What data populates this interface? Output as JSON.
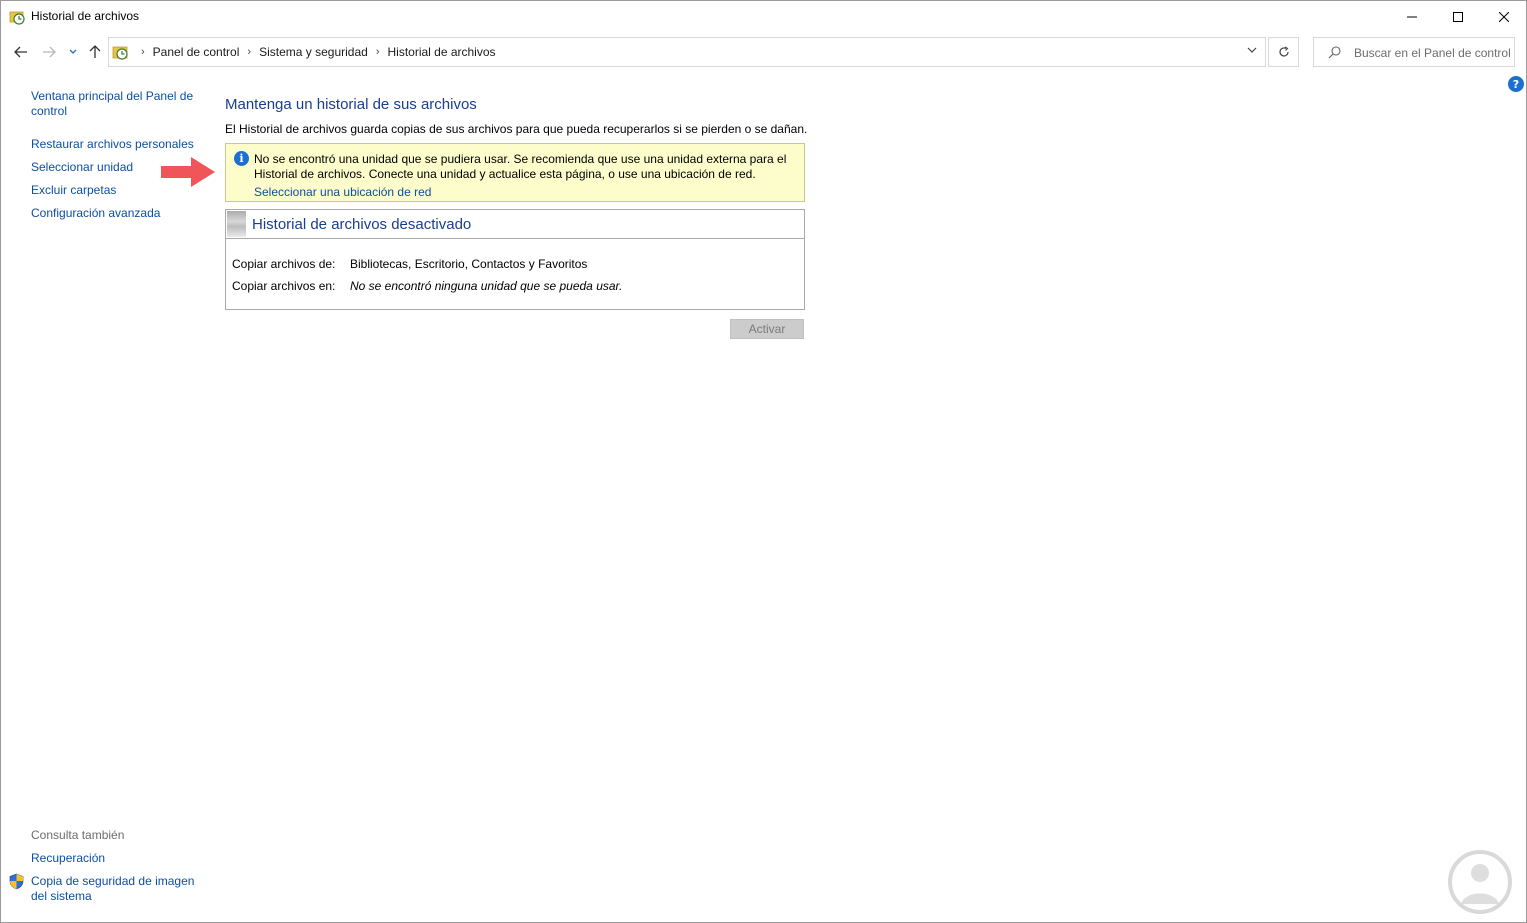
{
  "window": {
    "title": "Historial de archivos"
  },
  "address": {
    "crumbs": [
      "Panel de control",
      "Sistema y seguridad",
      "Historial de archivos"
    ]
  },
  "search": {
    "placeholder": "Buscar en el Panel de control"
  },
  "help": {
    "label": "?"
  },
  "leftnav": {
    "home_label": "Ventana principal del Panel de control",
    "items": [
      "Restaurar archivos personales",
      "Seleccionar unidad",
      "Excluir carpetas",
      "Configuración avanzada"
    ],
    "see_also_heading": "Consulta también",
    "see_also": [
      "Recuperación",
      "Copia de seguridad de imagen del sistema"
    ]
  },
  "main": {
    "title": "Mantenga un historial de sus archivos",
    "description": "El Historial de archivos guarda copias de sus archivos para que pueda recuperarlos si se pierden o se dañan.",
    "info": {
      "icon": "info-icon",
      "message": "No se encontró una unidad que se pudiera usar. Se recomienda que use una unidad externa para el Historial de archivos. Conecte una unidad y actualice esta página, o use una ubicación de red.",
      "link": "Seleccionar una ubicación de red"
    },
    "panel": {
      "title": "Historial de archivos desactivado",
      "rows": [
        {
          "label": "Copiar archivos de:",
          "value": "Bibliotecas, Escritorio, Contactos y Favoritos"
        },
        {
          "label": "Copiar archivos en:",
          "value": "No se encontró ninguna unidad que se pueda usar."
        }
      ]
    },
    "activate_button": "Activar"
  },
  "colors": {
    "link": "#0b4fa3",
    "heading": "#1a3e8c",
    "info_background": "#fdfdcc",
    "arrow": "#f0555a"
  }
}
